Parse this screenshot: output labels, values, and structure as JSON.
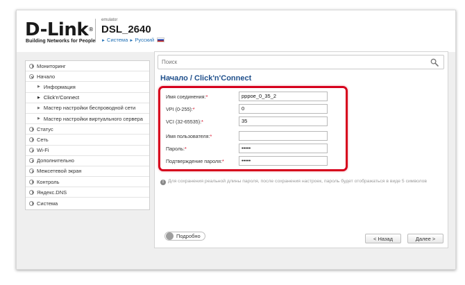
{
  "header": {
    "logo": "D-Link",
    "logo_reg": "®",
    "tagline": "Building Networks for People",
    "emulator": "emulator",
    "model": "DSL_2640",
    "breadcrumb_system": "Система",
    "breadcrumb_lang": "Русский"
  },
  "sidebar": {
    "items": [
      {
        "label": "Мониторинг"
      },
      {
        "label": "Начало"
      },
      {
        "label": "Информация"
      },
      {
        "label": "Click'n'Connect"
      },
      {
        "label": "Мастер настройки беспроводной сети"
      },
      {
        "label": "Мастер настройки виртуального сервера"
      },
      {
        "label": "Статус"
      },
      {
        "label": "Сеть"
      },
      {
        "label": "Wi-Fi"
      },
      {
        "label": "Дополнительно"
      },
      {
        "label": "Межсетевой экран"
      },
      {
        "label": "Контроль"
      },
      {
        "label": "Яндекс.DNS"
      },
      {
        "label": "Система"
      }
    ]
  },
  "search": {
    "placeholder": "Поиск"
  },
  "page": {
    "title": "Начало /  Click'n'Connect"
  },
  "form": {
    "fields": [
      {
        "label": "Имя соединения:",
        "value": "pppoe_0_35_2"
      },
      {
        "label": "VPI (0-255):",
        "value": "0"
      },
      {
        "label": "VCI (32-65535):",
        "value": "35"
      },
      {
        "label": "Имя пользователя:",
        "value": ""
      },
      {
        "label": "Пароль:",
        "value": "•••••"
      },
      {
        "label": "Подтверждение пароля:",
        "value": "•••••"
      }
    ],
    "required_mark": "*"
  },
  "note": {
    "text": "Для сохранения реальной длины пароля, после сохранения настроек, пароль будет отображаться в виде 5 символов"
  },
  "footer": {
    "toggle_label": "Подробно",
    "back_label": "< Назад",
    "next_label": "Далее >"
  },
  "colors": {
    "accent": "#1f4f8b",
    "highlight": "#d6001c",
    "link": "#1f6fb5"
  }
}
